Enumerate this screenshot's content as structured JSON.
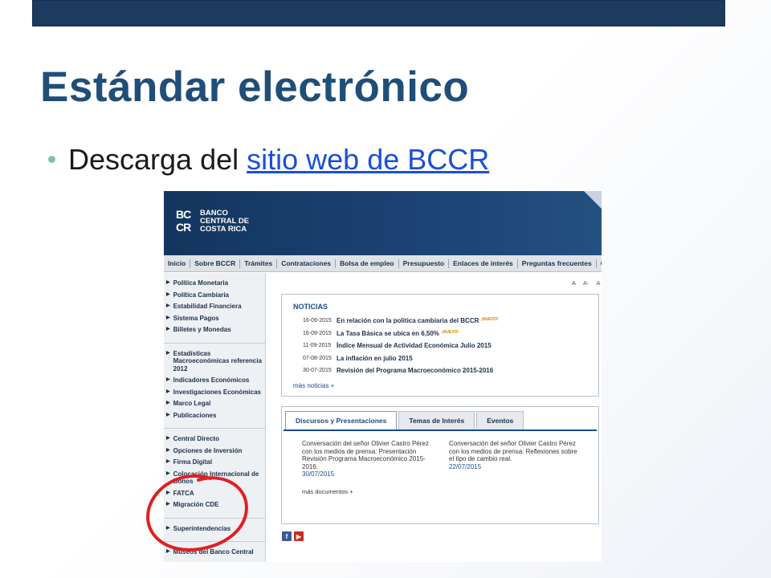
{
  "slide": {
    "title": "Estándar electrónico",
    "bullet_text": "Descarga del",
    "bullet_link": "sitio web de BCCR"
  },
  "site": {
    "logo_mark_line1": "BC",
    "logo_mark_line2": "CR",
    "logo_lines": [
      "BANCO",
      "CENTRAL DE",
      "COSTA RICA"
    ],
    "nav": [
      "Inicio",
      "Sobre BCCR",
      "Trámites",
      "Contrataciones",
      "Bolsa de empleo",
      "Presupuesto",
      "Enlaces de interés",
      "Preguntas frecuentes",
      "Co"
    ],
    "sidebar_groups": [
      [
        "Política Monetaria",
        "Política Cambiaria",
        "Estabilidad Financiera",
        "Sistema Pagos",
        "Billetes y Monedas"
      ],
      [
        "Estadísticas Macroeconómicas referencia 2012",
        "Indicadores Económicos",
        "Investigaciones Económicas",
        "Marco Legal",
        "Publicaciones"
      ],
      [
        "Central Directo",
        "Opciones de Inversión",
        "Firma Digital",
        "Colocación Internacional de Bonos",
        "FATCA",
        "Migración CDE"
      ],
      [
        "Superintendencias"
      ],
      [
        "Museos del Banco Central"
      ]
    ],
    "font_tools": [
      "A",
      "A-",
      "A"
    ],
    "news": {
      "title": "NOTICIAS",
      "items": [
        {
          "date": "16-09-2015",
          "headline": "En relación con la política cambiaria del BCCR",
          "badge": "¡NUEVO!"
        },
        {
          "date": "16-09-2015",
          "headline": "La Tasa Básica se ubica en 6,50%",
          "badge": "¡NUEVO!"
        },
        {
          "date": "11-09-2015",
          "headline": "Índice Mensual de Actividad Económica Julio 2015",
          "badge": ""
        },
        {
          "date": "07-08-2015",
          "headline": "La inflación en julio 2015",
          "badge": ""
        },
        {
          "date": "30-07-2015",
          "headline": "Revisión del Programa Macroeconómico 2015-2016",
          "badge": ""
        }
      ],
      "more": "más noticias +"
    },
    "tabs": [
      "Discursos y Presentaciones",
      "Temas de Interés",
      "Eventos"
    ],
    "documents": [
      {
        "text": "Conversación del señor Olivier Castro Pérez con los medios de prensa: Presentación Revisión Programa Macroeconómico 2015-2016.",
        "date": "30/07/2015"
      },
      {
        "text": "Conversación del señor Olivier Castro Pérez con los medios de prensa: Reflexiones sobre el tipo de cambio real.",
        "date": "22/07/2015"
      }
    ],
    "documents_more": "más documentos +",
    "social": [
      {
        "icon": "facebook-icon",
        "glyph": "f"
      },
      {
        "icon": "youtube-icon",
        "glyph": "▶"
      }
    ]
  },
  "colors": {
    "title": "#1f4e79",
    "link": "#1a4fd6",
    "header_bar": "#1d3a5f",
    "annotation_circle": "#e02020"
  }
}
